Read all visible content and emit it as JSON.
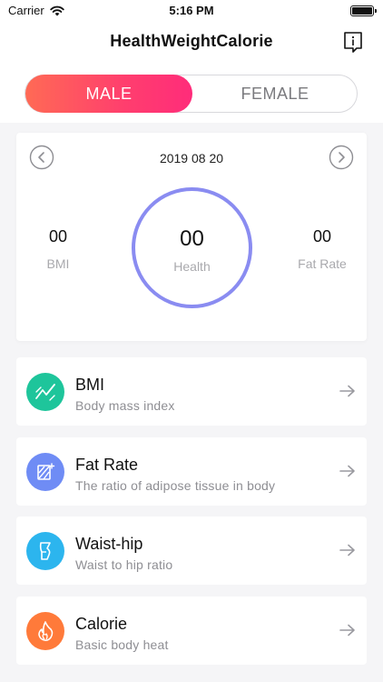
{
  "status_bar": {
    "carrier": "Carrier",
    "time": "5:16 PM"
  },
  "nav": {
    "title": "HealthWeightCalorie",
    "info_icon": "info-doc-icon"
  },
  "segment": {
    "male": "MALE",
    "female": "FEMALE",
    "selected": "MALE"
  },
  "summary": {
    "date": "2019 08 20",
    "left": {
      "value": "00",
      "label": "BMI"
    },
    "center": {
      "value": "00",
      "label": "Health"
    },
    "right": {
      "value": "00",
      "label": "Fat Rate"
    }
  },
  "items": [
    {
      "title": "BMI",
      "subtitle": "Body mass index",
      "icon": "trend-line-icon",
      "color": "#1ec59b"
    },
    {
      "title": "Fat Rate",
      "subtitle": "The ratio of adipose tissue in body",
      "icon": "body-fat-icon",
      "color": "#6f8cf5"
    },
    {
      "title": "Waist-hip",
      "subtitle": "Waist to hip ratio",
      "icon": "waist-icon",
      "color": "#2cb5ee"
    },
    {
      "title": "Calorie",
      "subtitle": "Basic body heat",
      "icon": "flame-icon",
      "color": "#ff7a3a"
    }
  ],
  "colors": {
    "accent_start": "#ff6a55",
    "accent_end": "#ff2c7a",
    "ring": "#8a8cf1"
  }
}
